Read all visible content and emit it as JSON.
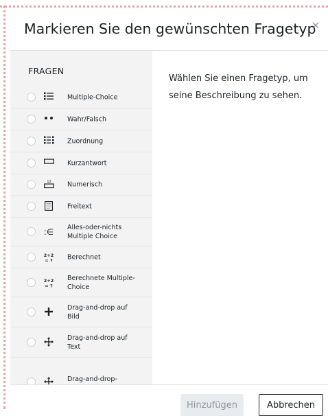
{
  "dialog": {
    "title": "Markieren Sie den gewünschten Fragetyp",
    "close_glyph": "×"
  },
  "sidebar": {
    "heading": "FRAGEN",
    "items": [
      {
        "label": "Multiple-Choice",
        "icon": "list-icon"
      },
      {
        "label": "Wahr/Falsch",
        "icon": "two-dots-icon"
      },
      {
        "label": "Zuordnung",
        "icon": "match-grid-icon"
      },
      {
        "label": "Kurzantwort",
        "icon": "short-answer-icon"
      },
      {
        "label": "Numerisch",
        "icon": "numeric-icon"
      },
      {
        "label": "Freitext",
        "icon": "essay-icon"
      },
      {
        "label": "Alles-oder-nichts Multiple Choice",
        "icon": "all-or-nothing-icon"
      },
      {
        "label": "Berechnet",
        "icon": "calculated-icon"
      },
      {
        "label": "Berechnete Multiple-Choice",
        "icon": "calculated-multichoice-icon"
      },
      {
        "label": "Drag-and-drop auf Bild",
        "icon": "drag-drop-image-icon"
      },
      {
        "label": "Drag-and-drop auf Text",
        "icon": "drag-drop-text-icon"
      },
      {
        "label": "Drag-and-drop-",
        "icon": "drag-drop-markers-icon"
      }
    ]
  },
  "content": {
    "description": "Wählen Sie einen Fragetyp, um seine Beschreibung zu sehen."
  },
  "footer": {
    "add_label": "Hinzufügen",
    "cancel_label": "Abbrechen"
  },
  "icon_glyphs": {
    "calc_top": "2+2",
    "calc_bottom": "= ?",
    "numeric_top": "12",
    "all_or_nothing": ":∈"
  },
  "colors": {
    "sidebar_bg": "#f3f3f3",
    "text": "#1d2125",
    "disabled_button_bg": "#e9ecef",
    "disabled_button_text": "#8f959e",
    "frame_dots": "#e7a2a6"
  }
}
